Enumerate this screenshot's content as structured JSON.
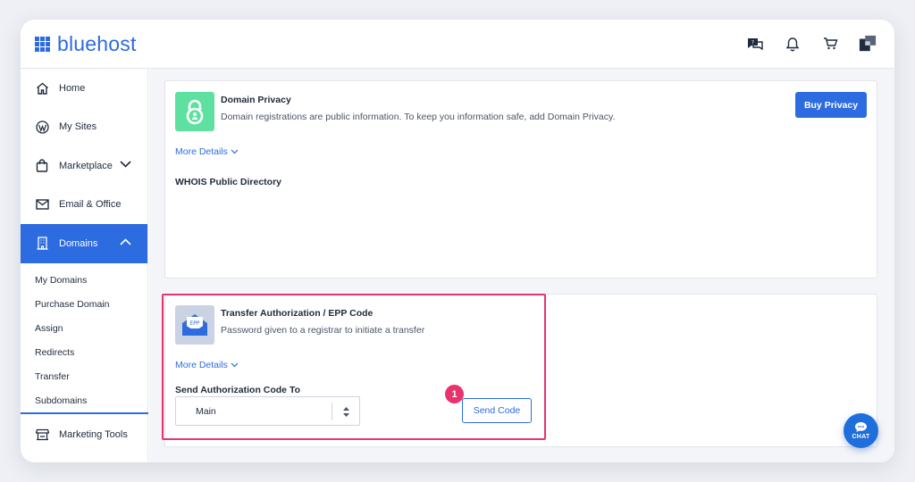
{
  "app": {
    "brand": "bluehost"
  },
  "header": {
    "icons": [
      "help-chat-icon",
      "bell-icon",
      "cart-icon",
      "account-icon"
    ]
  },
  "sidebar": {
    "items": [
      {
        "label": "Home",
        "icon": "home-icon"
      },
      {
        "label": "My Sites",
        "icon": "wordpress-icon"
      },
      {
        "label": "Marketplace",
        "icon": "shopping-bag-icon"
      },
      {
        "label": "Email & Office",
        "icon": "envelope-icon"
      },
      {
        "label": "Domains",
        "icon": "building-icon"
      }
    ],
    "sub_items": [
      "My Domains",
      "Purchase Domain",
      "Assign",
      "Redirects",
      "Transfer",
      "Subdomains"
    ],
    "bottom_item": {
      "label": "Marketing Tools",
      "icon": "storefront-icon"
    }
  },
  "privacy_card": {
    "title": "Domain Privacy",
    "description": "Domain registrations are public information. To keep you information safe, add Domain Privacy.",
    "more_details": "More Details",
    "whois": "WHOIS Public Directory",
    "button": "Buy Privacy"
  },
  "epp_card": {
    "title": "Transfer Authorization / EPP Code",
    "description": "Password given to a registrar to initiate a transfer",
    "more_details": "More Details",
    "field_label": "Send Authorization Code To",
    "select_value": "Main",
    "button": "Send Code",
    "icon_text": "EPP"
  },
  "annotation": {
    "step": "1"
  },
  "chat": {
    "label": "CHAT"
  },
  "colors": {
    "accent": "#2d6be0",
    "highlight": "#e8336e",
    "privacy_icon_bg": "#5ee0a0"
  }
}
